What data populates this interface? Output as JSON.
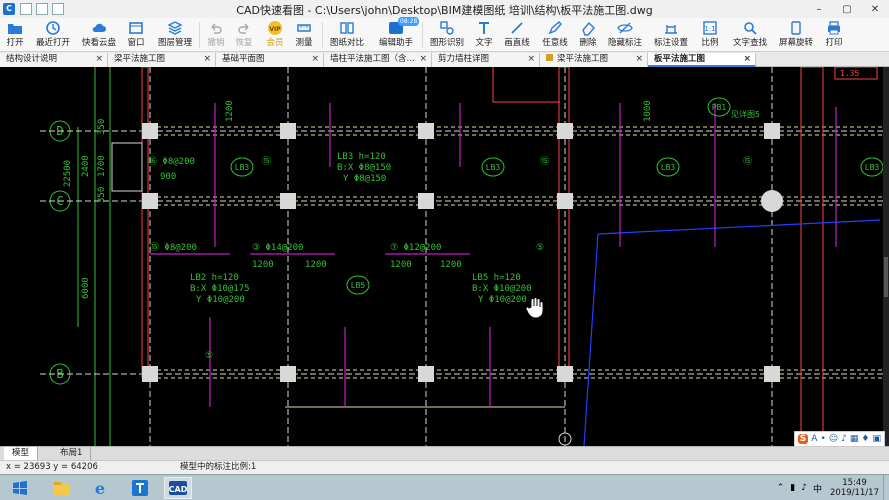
{
  "window": {
    "title": "CAD快速看图 - C:\\Users\\john\\Desktop\\BIM建模图纸  培训\\结构\\板平法施工图.dwg",
    "controls": [
      "–",
      "▢",
      "✕"
    ]
  },
  "toolbar": {
    "open": "打开",
    "recent": "最近打开",
    "cloud": "快看云盘",
    "window": "窗口",
    "layers": "图层管理",
    "undo": "撤销",
    "redo": "恢复",
    "vip": "会员",
    "vip_badge": "VIP",
    "measure": "测量",
    "compare": "图纸对比",
    "edit_assistant": "编辑助手",
    "edit_badge": "08:28",
    "shape_recog": "图形识别",
    "text": "文字",
    "line": "画直线",
    "freeline": "任意线",
    "delete": "删除",
    "hide_mark": "隐藏标注",
    "mark_settings": "标注设置",
    "scale": "比例",
    "text_search": "文字查找",
    "rotate": "屏幕旋转",
    "print": "打印"
  },
  "tabs": [
    {
      "label": "结构设计说明",
      "close": "×"
    },
    {
      "label": "梁平法施工图",
      "close": "×"
    },
    {
      "label": "基础平面图",
      "close": "×"
    },
    {
      "label": "墙柱平法施工图（含…",
      "close": "×"
    },
    {
      "label": "剪力墙柱详图",
      "close": "×"
    },
    {
      "label": "梁平法施工图",
      "close": "×"
    },
    {
      "label": "板平法施工图",
      "close": "×"
    }
  ],
  "drawing": {
    "grid_D": "D",
    "grid_C": "C",
    "grid_B": "B",
    "dim_350_top": "350",
    "dim_1700": "1700",
    "dim_350_bot": "350",
    "dim_2400": "2400",
    "dim_22500": "22500",
    "dim_6000": "6000",
    "dim_900": "900",
    "lb3_1": "LB3",
    "lb3_2": "LB3",
    "lb3_3": "LB3",
    "lb3_4": "LB3",
    "lb5": "LB5",
    "pb1": "PB1",
    "pb1_note": "见详图5",
    "lb3_h": "LB3 h=120",
    "lb3_bx": "B:X Φ8@150",
    "lb3_by": "Y Φ8@150",
    "lb2_h": "LB2 h=120",
    "lb2_bx": "B:X Φ10@175",
    "lb2_by": "Y Φ10@200",
    "lb5_h": "LB5 h=120",
    "lb5_bx": "B:X Φ10@200",
    "lb5_by": "Y Φ10@200",
    "r16_8_200": "⑯ Φ8@200",
    "r15_8_200": "⑮ Φ8@200",
    "r3_14_200": "③ Φ14@200",
    "r7_12_200": "⑦ Φ12@200",
    "d1200": "1200",
    "n15": "⑮",
    "n5": "⑤",
    "n1000": "1000",
    "r_top": "1.35"
  },
  "layout_tabs": [
    "模型",
    "布局1"
  ],
  "statusbar": {
    "coords": "x = 23693  y = 64206",
    "scale_text": "模型中的标注比例:1"
  },
  "clock": {
    "time": "15:49",
    "date": "2019/11/17"
  },
  "taskbar_icons": [
    "start-icon",
    "file-explorer-icon",
    "ie-icon",
    "text-app-icon",
    "cad-icon"
  ],
  "colors": {
    "line_white": "#d9d9d9",
    "green_text": "#33c033",
    "magenta": "#c020c0",
    "red_wall": "#ff4040",
    "column_gray": "#d8d8d8",
    "blue_line": "#2040ff"
  }
}
